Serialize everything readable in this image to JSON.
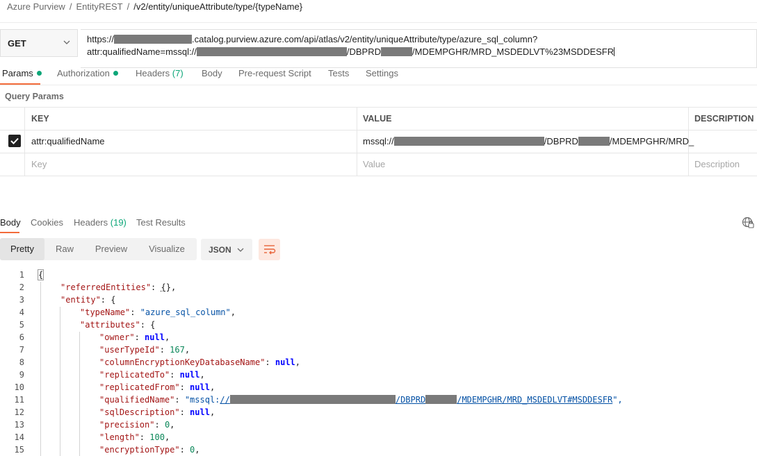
{
  "breadcrumb": {
    "items": [
      "Azure Purview",
      "EntityREST",
      "/v2/entity/uniqueAttribute/type/{typeName}"
    ],
    "separator": "/"
  },
  "request": {
    "method": "GET",
    "url_line1_prefix": "https://",
    "url_line1_suffix": ".catalog.purview.azure.com/api/atlas/v2/entity/uniqueAttribute/type/azure_sql_column?",
    "url_line2_prefix": "attr:qualifiedName=mssql://",
    "url_line2_mid": "/DBPRD",
    "url_line2_suffix": "/MDEMPGHR/MRD_MSDEDLVT%23MSDDESFR"
  },
  "request_tabs": [
    {
      "label": "Params",
      "dot": true
    },
    {
      "label": "Authorization",
      "dot": true
    },
    {
      "label": "Headers",
      "count": "(7)"
    },
    {
      "label": "Body"
    },
    {
      "label": "Pre-request Script"
    },
    {
      "label": "Tests"
    },
    {
      "label": "Settings"
    }
  ],
  "query_params": {
    "title": "Query Params",
    "columns": [
      "KEY",
      "VALUE",
      "DESCRIPTION"
    ],
    "rows": [
      {
        "checked": true,
        "key": "attr:qualifiedName",
        "value_prefix": "mssql://",
        "value_mid": "/DBPRD",
        "value_suffix": "/MDEMPGHR/MRD_"
      }
    ],
    "placeholders": {
      "key": "Key",
      "value": "Value",
      "description": "Description"
    }
  },
  "response_tabs": [
    {
      "label": "Body"
    },
    {
      "label": "Cookies"
    },
    {
      "label": "Headers",
      "count": "(19)"
    },
    {
      "label": "Test Results"
    }
  ],
  "view_modes": [
    "Pretty",
    "Raw",
    "Preview",
    "Visualize"
  ],
  "format": "JSON",
  "code_lines": [
    "1",
    "2",
    "3",
    "4",
    "5",
    "6",
    "7",
    "8",
    "9",
    "10",
    "11",
    "12",
    "13",
    "14",
    "15"
  ],
  "json": {
    "referredEntities": "\"referredEntities\"",
    "entity": "\"entity\"",
    "typeName_key": "\"typeName\"",
    "typeName_val": "\"azure_sql_column\"",
    "attributes": "\"attributes\"",
    "owner": "\"owner\"",
    "userTypeId": "\"userTypeId\"",
    "userTypeId_val": "167",
    "columnEncryptionKeyDatabaseName": "\"columnEncryptionKeyDatabaseName\"",
    "replicatedTo": "\"replicatedTo\"",
    "replicatedFrom": "\"replicatedFrom\"",
    "qualifiedName": "\"qualifiedName\"",
    "qn_prefix": "\"mssql:",
    "qn_link1": "//",
    "qn_link2": "/DBPRD",
    "qn_link3": "/MDEMPGHR/MRD_MSDEDLVT#MSDDESFR",
    "qn_suffix": "\",",
    "sqlDescription": "\"sqlDescription\"",
    "precision": "\"precision\"",
    "precision_val": "0",
    "length": "\"length\"",
    "length_val": "100",
    "encryptionType": "\"encryptionType\"",
    "encryptionType_val": "0",
    "null": "null"
  }
}
